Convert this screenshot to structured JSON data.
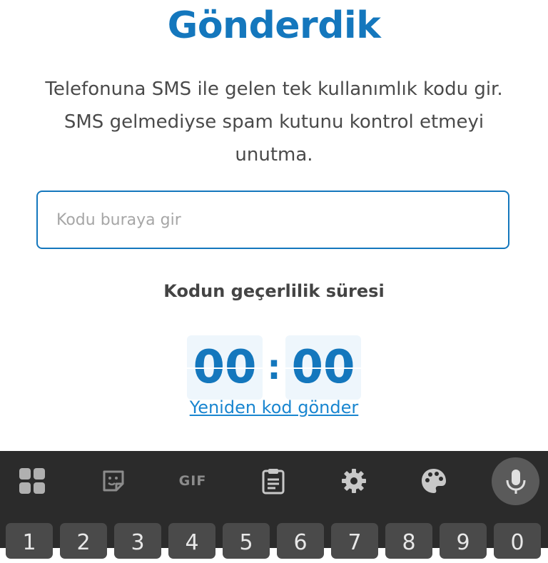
{
  "header": {
    "title": "Gönderdik"
  },
  "description": {
    "line1": "Telefonuna SMS ile gelen tek kullanımlık kodu gir.",
    "line2": "SMS gelmediyse spam kutunu kontrol etmeyi",
    "line3": "unutma."
  },
  "code_input": {
    "placeholder": "Kodu buraya gir",
    "value": ""
  },
  "validity": {
    "label": "Kodun geçerlilik süresi",
    "minutes": "00",
    "separator": ":",
    "seconds": "00"
  },
  "resend": {
    "label": "Yeniden kod gönder"
  },
  "keyboard": {
    "toolbar": [
      {
        "icon": "apps-grid-icon"
      },
      {
        "icon": "sticker-icon"
      },
      {
        "icon": "gif-icon",
        "label": "GIF"
      },
      {
        "icon": "clipboard-icon"
      },
      {
        "icon": "settings-gear-icon"
      },
      {
        "icon": "theme-palette-icon"
      },
      {
        "icon": "microphone-icon"
      }
    ],
    "number_row": [
      "1",
      "2",
      "3",
      "4",
      "5",
      "6",
      "7",
      "8",
      "9",
      "0"
    ]
  },
  "colors": {
    "accent": "#1477bd",
    "link": "#1a86d0",
    "keyboard_bg": "#2b2b2b",
    "key_bg": "#4a4a4a"
  }
}
